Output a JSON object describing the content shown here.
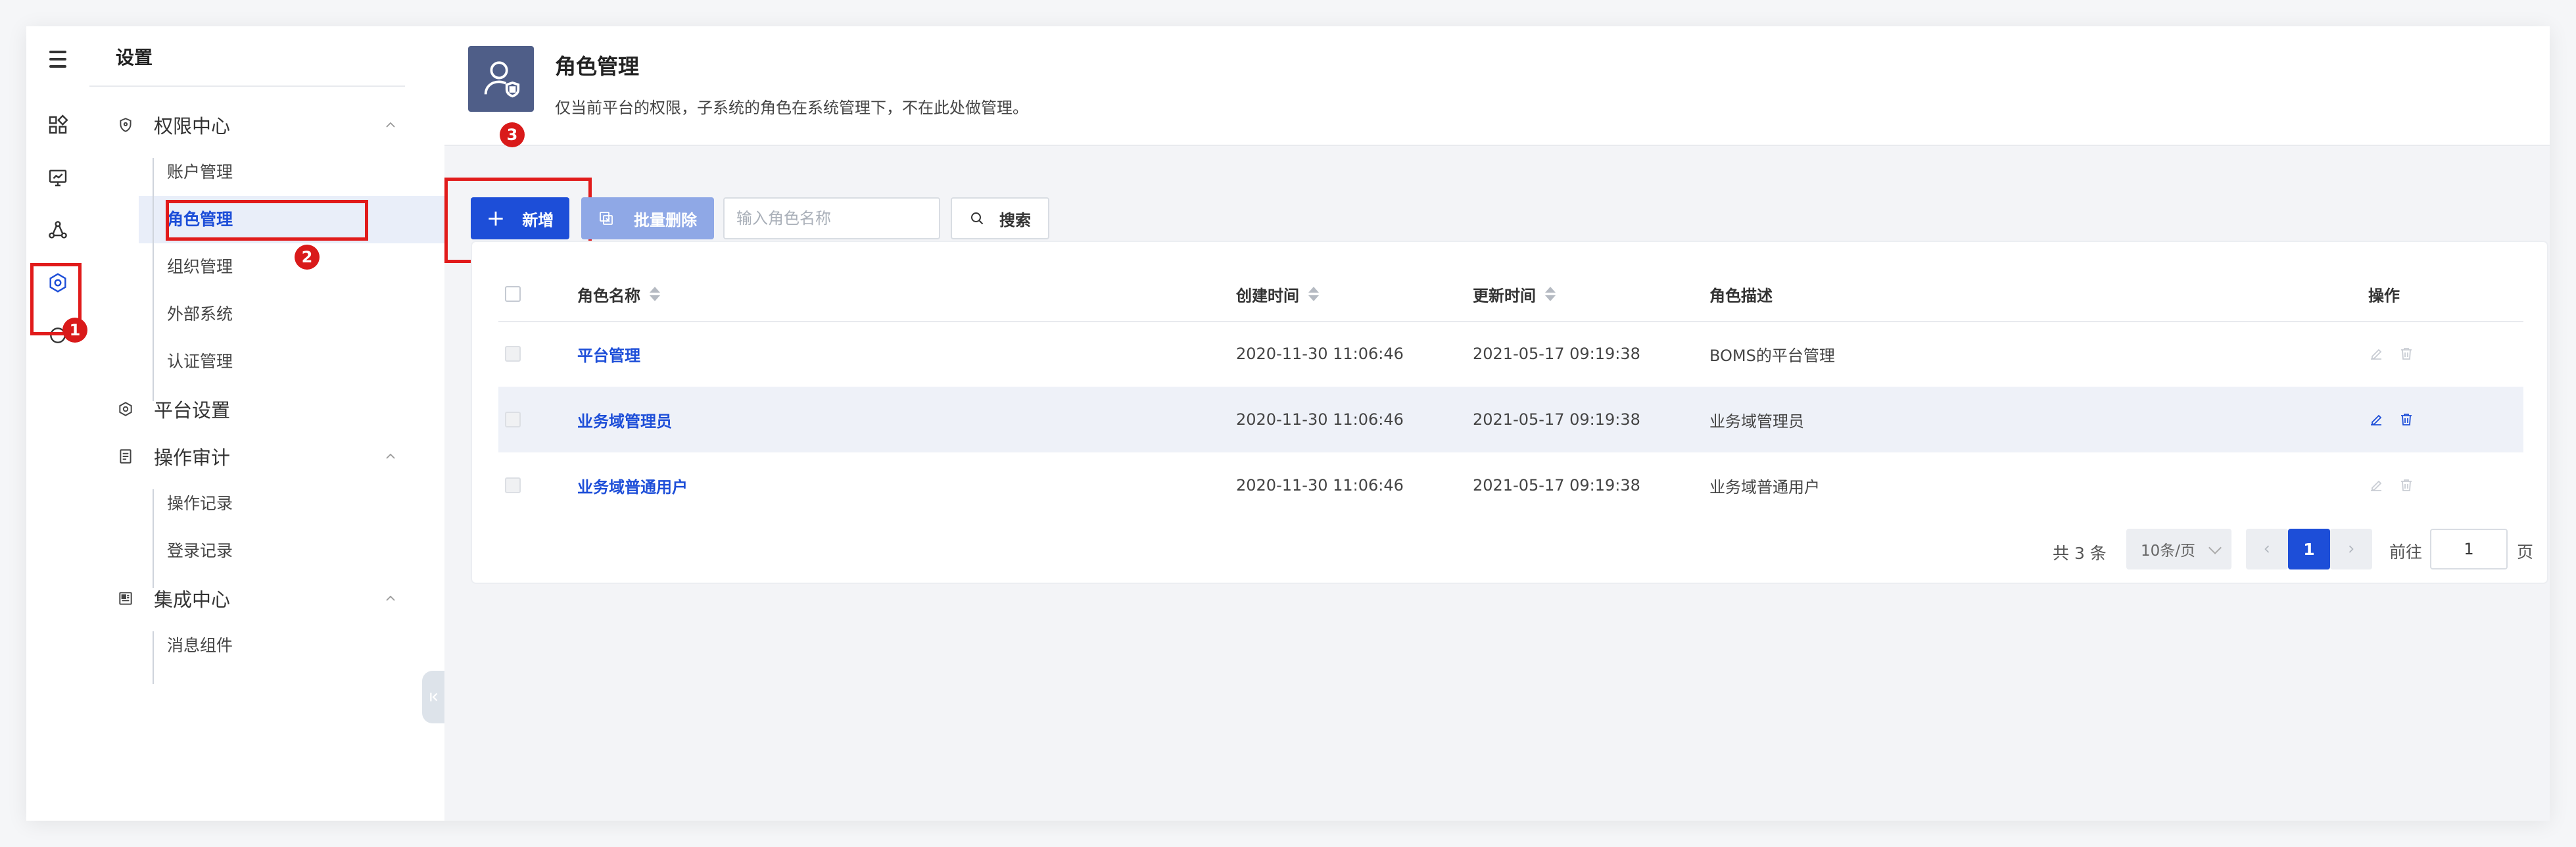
{
  "sidebar": {
    "title": "设置",
    "groups": [
      {
        "label": "权限中心",
        "icon": "shield-icon",
        "expanded": true,
        "items": [
          {
            "label": "账户管理"
          },
          {
            "label": "角色管理",
            "active": true
          },
          {
            "label": "组织管理"
          },
          {
            "label": "外部系统"
          },
          {
            "label": "认证管理"
          }
        ]
      },
      {
        "label": "平台设置",
        "icon": "platform-settings-icon",
        "expanded": false,
        "items": []
      },
      {
        "label": "操作审计",
        "icon": "document-icon",
        "expanded": true,
        "items": [
          {
            "label": "操作记录"
          },
          {
            "label": "登录记录"
          }
        ]
      },
      {
        "label": "集成中心",
        "icon": "integration-icon",
        "expanded": true,
        "items": [
          {
            "label": "消息组件"
          }
        ]
      }
    ]
  },
  "annotations": {
    "badge1": "1",
    "badge2": "2",
    "badge3": "3",
    "highlight_color": "#e11b1b"
  },
  "header": {
    "title": "角色管理",
    "description": "仅当前平台的权限，子系统的角色在系统管理下，不在此处做管理。"
  },
  "toolbar": {
    "add_label": "新增",
    "batch_delete_label": "批量删除",
    "search_placeholder": "输入角色名称",
    "search_label": "搜索"
  },
  "table": {
    "columns": {
      "name": "角色名称",
      "created": "创建时间",
      "updated": "更新时间",
      "desc": "角色描述",
      "ops": "操作"
    },
    "rows": [
      {
        "name": "平台管理",
        "created": "2020-11-30 11:06:46",
        "updated": "2021-05-17 09:19:38",
        "desc": "BOMS的平台管理",
        "editable": false
      },
      {
        "name": "业务域管理员",
        "created": "2020-11-30 11:06:46",
        "updated": "2021-05-17 09:19:38",
        "desc": "业务域管理员",
        "editable": true
      },
      {
        "name": "业务域普通用户",
        "created": "2020-11-30 11:06:46",
        "updated": "2021-05-17 09:19:38",
        "desc": "业务域普通用户",
        "editable": false
      }
    ]
  },
  "pagination": {
    "total_text": "共 3 条",
    "page_size": "10条/页",
    "current_page": "1",
    "goto_label": "前往",
    "goto_value": "1",
    "page_suffix": "页"
  },
  "colors": {
    "primary": "#1d4ed8",
    "primary_disabled": "#8fa8e6"
  }
}
